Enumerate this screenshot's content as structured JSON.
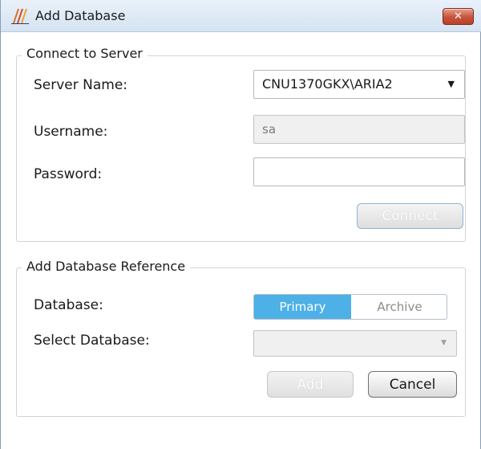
{
  "window": {
    "title": "Add Database",
    "close_label": "✕"
  },
  "connect_group": {
    "legend": "Connect to Server",
    "server_name_label": "Server Name:",
    "server_name_value": "CNU1370GKX\\ARIA2",
    "username_label": "Username:",
    "username_value": "sa",
    "password_label": "Password:",
    "password_value": "",
    "connect_label": "Connect"
  },
  "reference_group": {
    "legend": "Add Database Reference",
    "database_label": "Database:",
    "database_options": [
      "Primary",
      "Archive"
    ],
    "database_selected": "Primary",
    "select_database_label": "Select Database:",
    "select_database_value": "",
    "add_label": "Add",
    "cancel_label": "Cancel"
  },
  "icons": {
    "app": "app-logo-icon",
    "close": "close-icon",
    "dropdown": "chevron-down-icon"
  },
  "colors": {
    "accent": "#4db0e6",
    "close_button": "#c7523a"
  }
}
